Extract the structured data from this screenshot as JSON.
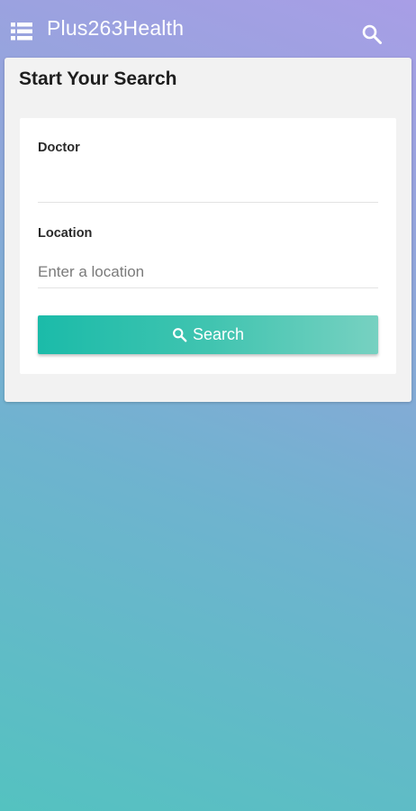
{
  "header": {
    "title": "Plus263Health",
    "menu_icon": "list-icon",
    "search_icon": "search-icon"
  },
  "search_panel": {
    "title": "Start Your Search",
    "doctor": {
      "label": "Doctor",
      "value": "",
      "placeholder": ""
    },
    "location": {
      "label": "Location",
      "value": "",
      "placeholder": "Enter a location"
    },
    "search_button": {
      "label": "Search",
      "icon": "search-icon"
    }
  },
  "colors": {
    "accent": "#1bbba9",
    "background_top": "#a89ee6",
    "background_bottom": "#54c2c0"
  }
}
